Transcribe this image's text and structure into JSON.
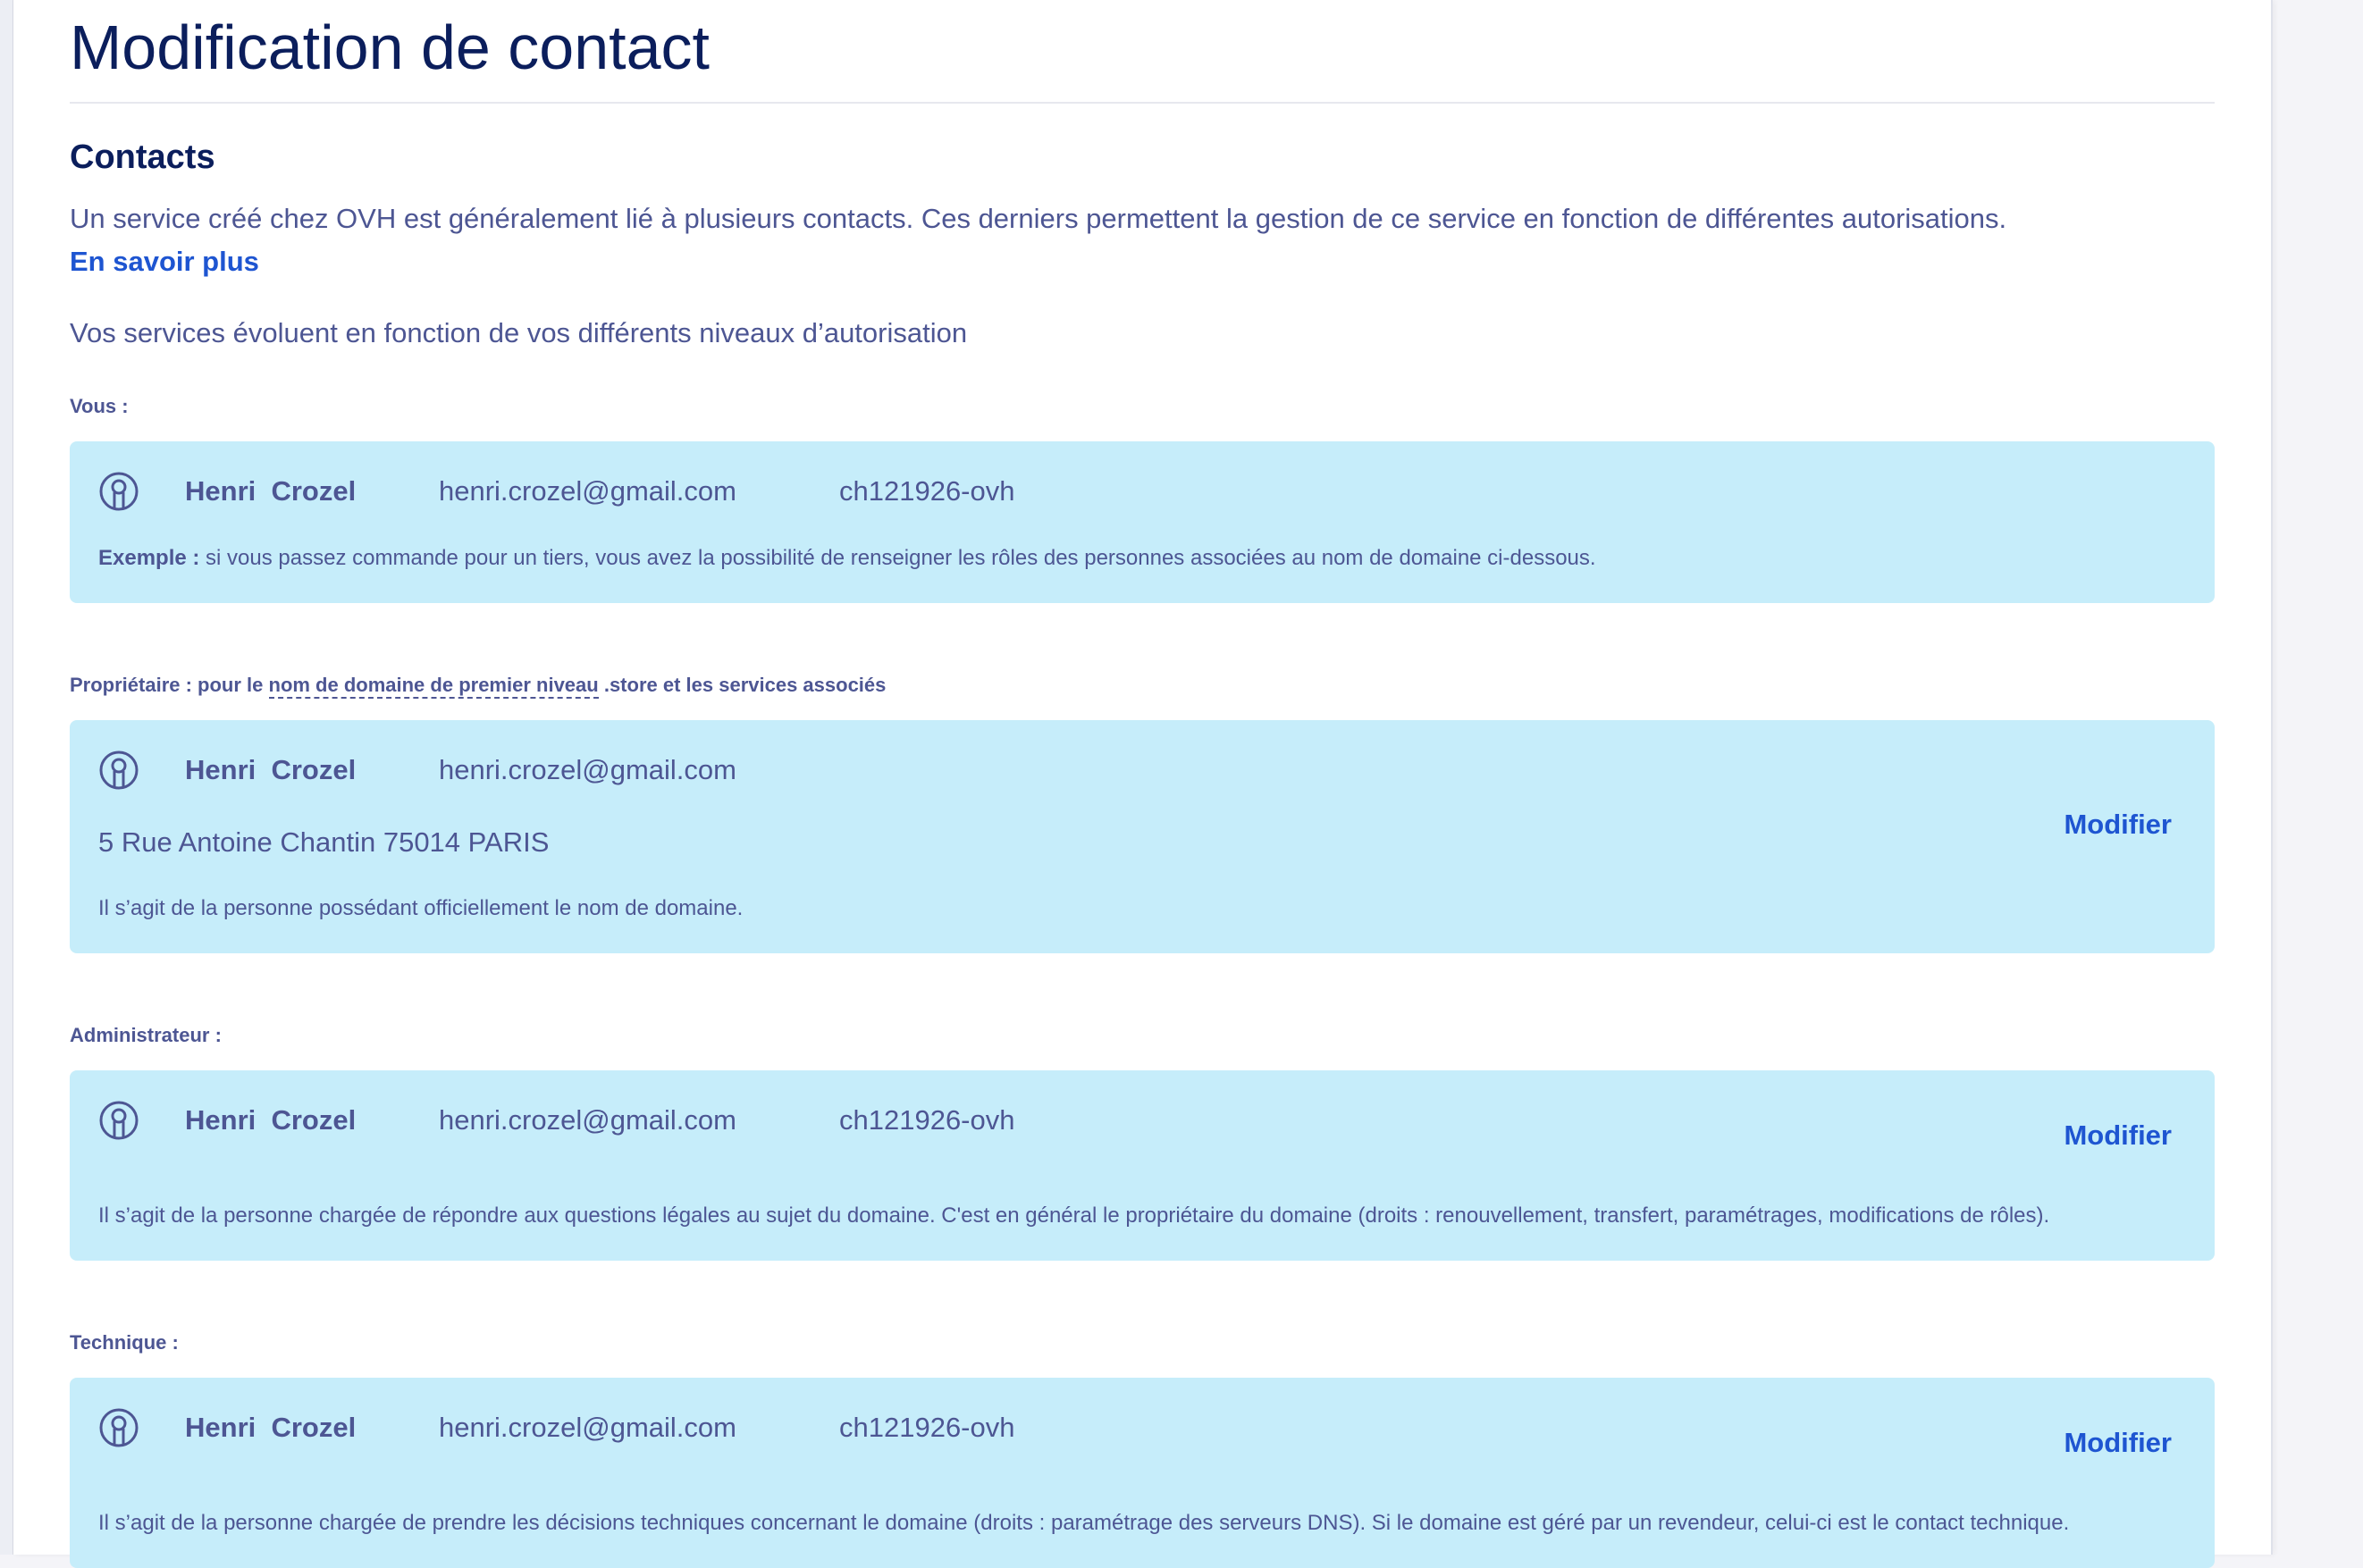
{
  "page": {
    "title": "Modification de contact"
  },
  "contacts_section": {
    "title": "Contacts",
    "intro": "Un service créé chez OVH est généralement lié à plusieurs contacts. Ces derniers permettent la gestion de ce service en fonction de différentes autorisations.",
    "learn_more": "En savoir plus",
    "evolve_text": "Vos services évoluent en fonction de vos différents niveaux d’autorisation"
  },
  "you": {
    "label": "Vous :",
    "name": "Henri  Crozel",
    "email": "henri.crozel@gmail.com",
    "nic": "ch121926-ovh",
    "example_bold": "Exemple :",
    "example_text": " si vous passez commande pour un tiers, vous avez la possibilité de renseigner les rôles des personnes associées au nom de domaine ci-dessous."
  },
  "owner": {
    "label_prefix": "Propriétaire : pour le ",
    "label_term": "nom de domaine de premier niveau",
    "label_suffix": " .store et les services associés",
    "name": "Henri  Crozel",
    "email": "henri.crozel@gmail.com",
    "address": "5 Rue Antoine Chantin 75014 PARIS",
    "description": "Il s’agit de la personne possédant officiellement le nom de domaine.",
    "modify_label": "Modifier"
  },
  "admin": {
    "label": "Administrateur :",
    "name": "Henri  Crozel",
    "email": "henri.crozel@gmail.com",
    "nic": "ch121926-ovh",
    "description": "Il s’agit de la personne chargée de répondre aux questions légales au sujet du domaine. C'est en général le propriétaire du domaine (droits : renouvellement, transfert, paramétrages, modifications de rôles).",
    "modify_label": "Modifier"
  },
  "tech": {
    "label": "Technique :",
    "name": "Henri  Crozel",
    "email": "henri.crozel@gmail.com",
    "nic": "ch121926-ovh",
    "description": "Il s’agit de la personne chargée de prendre les décisions techniques concernant le domaine (droits : paramétrage des serveurs DNS). Si le domaine est géré par un revendeur, celui-ci est le contact technique.",
    "modify_label": "Modifier"
  },
  "icons": {
    "contact": "user-circle-icon"
  },
  "colors": {
    "title": "#0b1e5c",
    "text": "#4d5693",
    "link": "#1e55d1",
    "card_bg": "#c6edfa"
  }
}
